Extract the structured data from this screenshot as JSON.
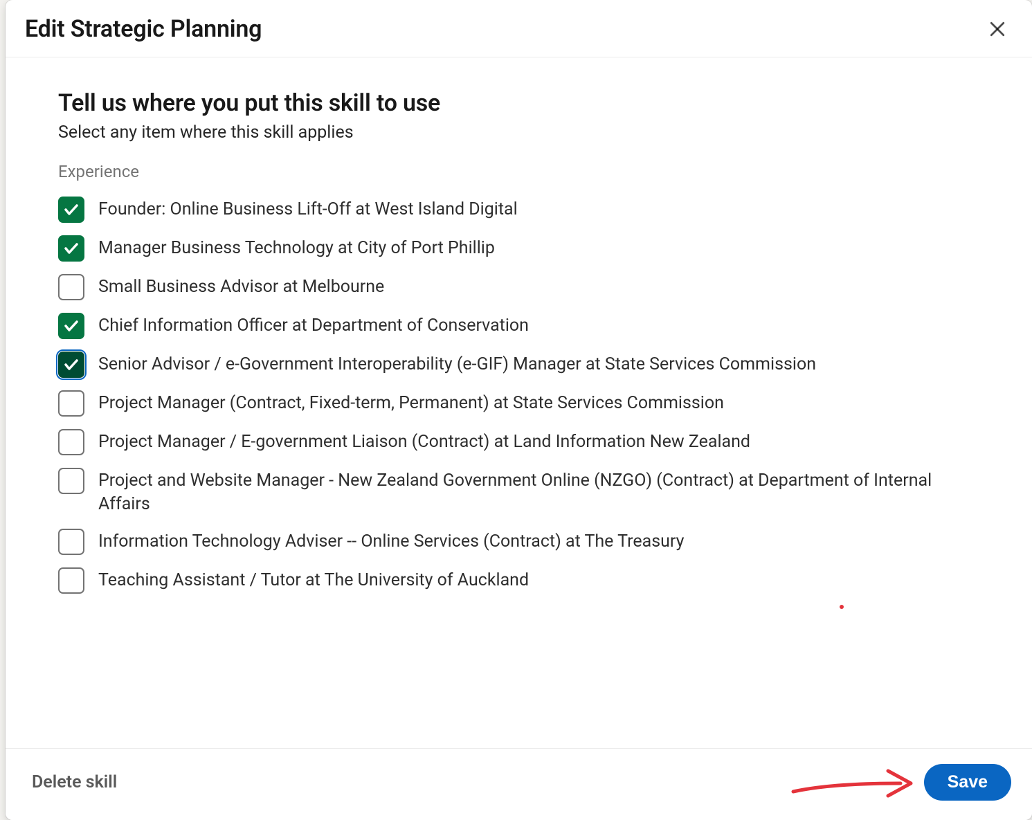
{
  "modal": {
    "title": "Edit Strategic Planning",
    "heading": "Tell us where you put this skill to use",
    "subheading": "Select any item where this skill applies",
    "category_label": "Experience",
    "footer": {
      "delete_label": "Delete skill",
      "save_label": "Save"
    }
  },
  "experience_items": [
    {
      "label": "Founder: Online Business Lift-Off at West Island Digital",
      "checked": true,
      "focused": false
    },
    {
      "label": "Manager Business Technology at City of Port Phillip",
      "checked": true,
      "focused": false
    },
    {
      "label": "Small Business Advisor at Melbourne",
      "checked": false,
      "focused": false
    },
    {
      "label": "Chief Information Officer at Department of Conservation",
      "checked": true,
      "focused": false
    },
    {
      "label": "Senior Advisor / e-Government Interoperability (e-GIF) Manager at State Services Commission",
      "checked": true,
      "focused": true
    },
    {
      "label": "Project Manager (Contract, Fixed-term, Permanent) at State Services Commission",
      "checked": false,
      "focused": false
    },
    {
      "label": "Project Manager / E-government Liaison (Contract) at Land Information New Zealand",
      "checked": false,
      "focused": false
    },
    {
      "label": "Project and Website Manager - New Zealand Government Online (NZGO) (Contract) at Department of Internal Affairs",
      "checked": false,
      "focused": false
    },
    {
      "label": "Information Technology Adviser -- Online Services (Contract) at The Treasury",
      "checked": false,
      "focused": false
    },
    {
      "label": "Teaching Assistant / Tutor at The University of Auckland",
      "checked": false,
      "focused": false
    }
  ]
}
